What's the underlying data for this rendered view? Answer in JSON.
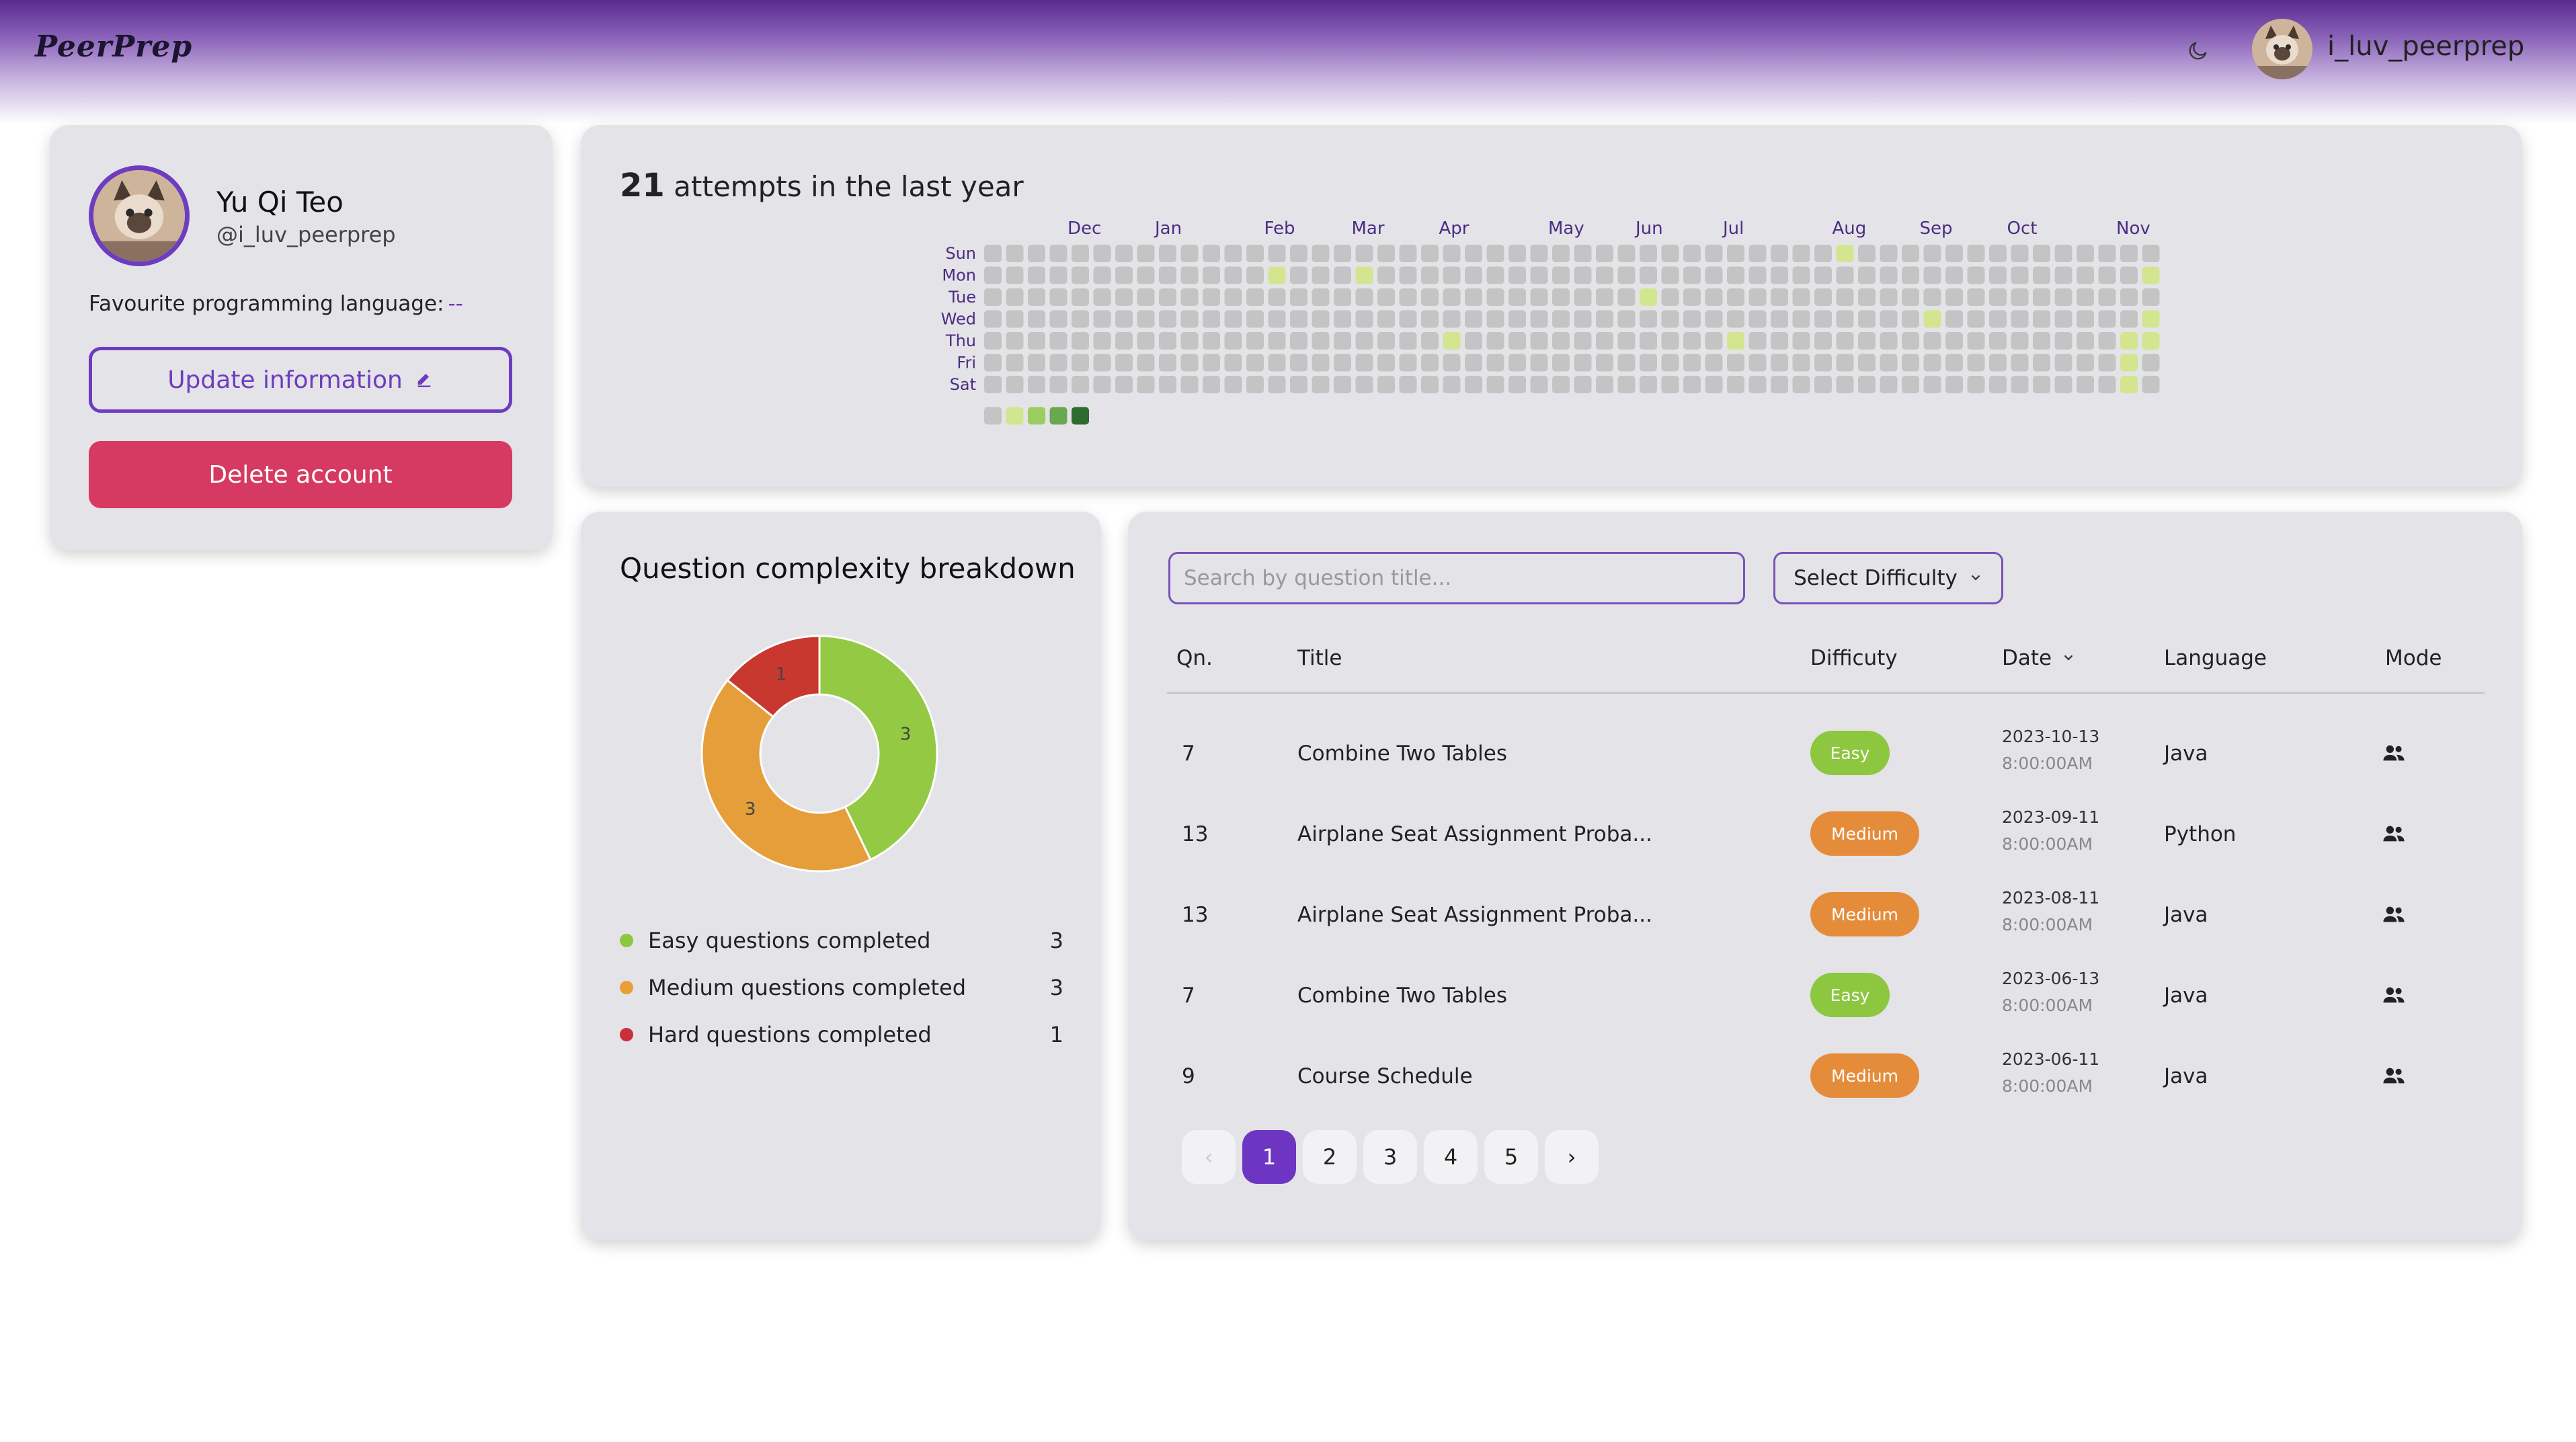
{
  "header": {
    "brand": "PeerPrep",
    "username": "i_luv_peerprep",
    "theme_icon": "moon-icon"
  },
  "profile": {
    "name": "Yu Qi Teo",
    "handle": "@i_luv_peerprep",
    "fav_label": "Favourite programming language:",
    "fav_value": "--",
    "update_label": "Update information",
    "delete_label": "Delete account"
  },
  "heatmap": {
    "count": "21",
    "title_suffix": "attempts in the last year",
    "months": [
      "Dec",
      "Jan",
      "Feb",
      "Mar",
      "Apr",
      "May",
      "Jun",
      "Jul",
      "Aug",
      "Sep",
      "Oct",
      "Nov"
    ],
    "days": [
      "Sun",
      "Mon",
      "Tue",
      "Wed",
      "Thu",
      "Fri",
      "Sat"
    ],
    "colors": {
      "empty": "#c4c4c4",
      "level1": "#d4e58f",
      "level2": "#9ccd60",
      "level3": "#6aa84f",
      "level4": "#2e6b30"
    },
    "active_cells": [
      [
        39,
        0
      ],
      [
        13,
        1
      ],
      [
        17,
        1
      ],
      [
        53,
        1
      ],
      [
        30,
        2
      ],
      [
        43,
        3
      ],
      [
        53,
        3
      ],
      [
        21,
        4
      ],
      [
        34,
        4
      ],
      [
        52,
        4
      ],
      [
        53,
        4
      ],
      [
        52,
        5
      ],
      [
        52,
        6
      ]
    ]
  },
  "breakdown": {
    "title": "Question complexity breakdown",
    "items": [
      {
        "label": "Easy questions completed",
        "count": "3",
        "color": "#8dc63f"
      },
      {
        "label": "Medium questions completed",
        "count": "3",
        "color": "#e8a035"
      },
      {
        "label": "Hard questions completed",
        "count": "1",
        "color": "#c9303c"
      }
    ],
    "slice_colors": {
      "easy": "#94c943",
      "medium": "#e59e3a",
      "hard": "#c8382e"
    }
  },
  "chart_data": {
    "type": "pie",
    "categories": [
      "Easy",
      "Medium",
      "Hard"
    ],
    "values": [
      3,
      3,
      1
    ],
    "title": "Question complexity breakdown"
  },
  "history": {
    "search_placeholder": "Search by question title...",
    "difficulty_label": "Select Difficulty",
    "columns": {
      "qn": "Qn.",
      "title": "Title",
      "difficulty": "Difficuty",
      "date": "Date",
      "language": "Language",
      "mode": "Mode"
    },
    "rows": [
      {
        "qn": "7",
        "title": "Combine Two Tables",
        "difficulty": "Easy",
        "date": "2023-10-13",
        "time": "8:00:00AM",
        "language": "Java"
      },
      {
        "qn": "13",
        "title": "Airplane Seat Assignment Proba...",
        "difficulty": "Medium",
        "date": "2023-09-11",
        "time": "8:00:00AM",
        "language": "Python"
      },
      {
        "qn": "13",
        "title": "Airplane Seat Assignment Proba...",
        "difficulty": "Medium",
        "date": "2023-08-11",
        "time": "8:00:00AM",
        "language": "Java"
      },
      {
        "qn": "7",
        "title": "Combine Two Tables",
        "difficulty": "Easy",
        "date": "2023-06-13",
        "time": "8:00:00AM",
        "language": "Java"
      },
      {
        "qn": "9",
        "title": "Course Schedule",
        "difficulty": "Medium",
        "date": "2023-06-11",
        "time": "8:00:00AM",
        "language": "Java"
      }
    ],
    "badge_colors": {
      "Easy": "#8dc63f",
      "Medium": "#e58c3b"
    },
    "pagination": {
      "prev": "‹",
      "pages": [
        "1",
        "2",
        "3",
        "4",
        "5"
      ],
      "current": "1",
      "next": "›"
    }
  }
}
